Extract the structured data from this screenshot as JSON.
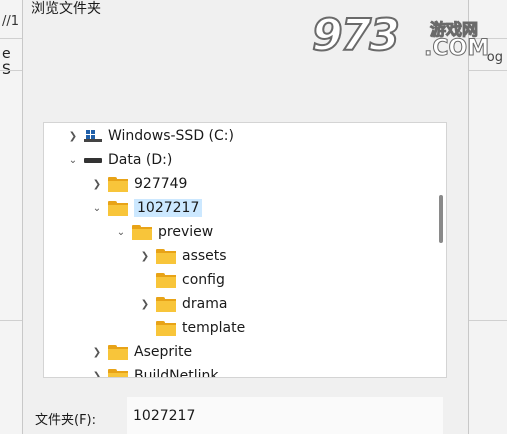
{
  "background": {
    "left_url_fragment": "//1",
    "left_text_fragment": "e S",
    "right_text_fragment": "og"
  },
  "dialog": {
    "title": "浏览文件夹"
  },
  "tree": {
    "items": [
      {
        "label": "Windows-SSD (C:)",
        "icon": "windows-drive-icon",
        "expander": "collapsed"
      },
      {
        "label": "Data (D:)",
        "icon": "drive-icon",
        "expander": "expanded"
      },
      {
        "label": "927749",
        "icon": "folder-icon",
        "expander": "collapsed"
      },
      {
        "label": "1027217",
        "icon": "folder-icon",
        "expander": "expanded",
        "selected": true
      },
      {
        "label": "preview",
        "icon": "folder-icon",
        "expander": "expanded"
      },
      {
        "label": "assets",
        "icon": "folder-icon",
        "expander": "collapsed"
      },
      {
        "label": "config",
        "icon": "folder-icon",
        "expander": "none"
      },
      {
        "label": "drama",
        "icon": "folder-icon",
        "expander": "collapsed"
      },
      {
        "label": "template",
        "icon": "folder-icon",
        "expander": "none"
      },
      {
        "label": "Aseprite",
        "icon": "folder-icon",
        "expander": "collapsed"
      },
      {
        "label": "BuildNetlink",
        "icon": "folder-icon",
        "expander": "collapsed"
      }
    ]
  },
  "folder_field": {
    "label": "文件夹(F):",
    "value": "1027217"
  },
  "watermark": {
    "digits": "973",
    "cn": "游戏网",
    "com": ".COM"
  },
  "colors": {
    "selection": "#cce8ff",
    "folder": "#f8c53a",
    "folder_dark": "#e8a317"
  }
}
